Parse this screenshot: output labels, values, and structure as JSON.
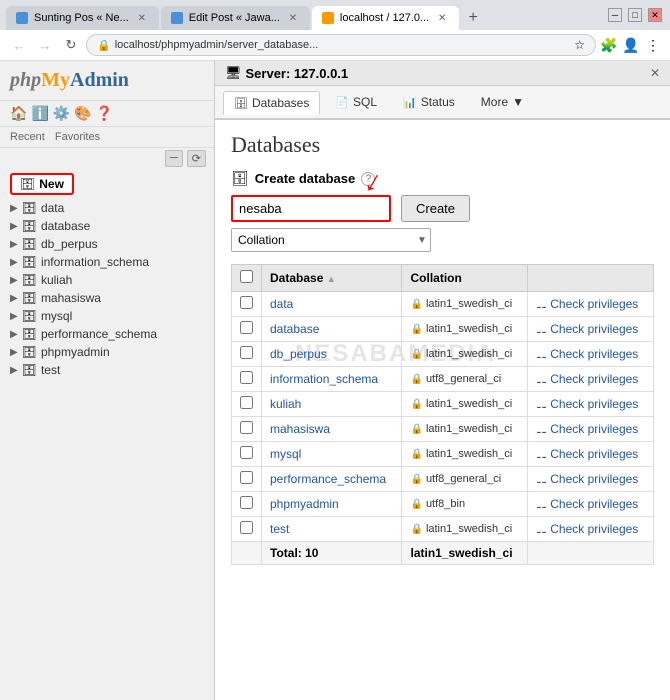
{
  "browser": {
    "tabs": [
      {
        "id": "tab1",
        "title": "Sunting Pos « Ne...",
        "favicon_color": "#4a90d9",
        "active": false
      },
      {
        "id": "tab2",
        "title": "Edit Post « Jawa...",
        "favicon_color": "#4a90d9",
        "active": false
      },
      {
        "id": "tab3",
        "title": "localhost / 127.0...",
        "favicon_color": "#f90",
        "active": true
      }
    ],
    "address": "localhost/phpmyadmin/server_database...",
    "new_tab_label": "+"
  },
  "sidebar": {
    "logo": "phpMyAdmin",
    "logo_php": "php",
    "logo_my": "My",
    "logo_admin": "Admin",
    "recent_label": "Recent",
    "favorites_label": "Favorites",
    "new_label": "New",
    "databases": [
      {
        "name": "data"
      },
      {
        "name": "database"
      },
      {
        "name": "db_perpus"
      },
      {
        "name": "information_schema"
      },
      {
        "name": "kuliah"
      },
      {
        "name": "mahasiswa"
      },
      {
        "name": "mysql"
      },
      {
        "name": "performance_schema"
      },
      {
        "name": "phpmyadmin"
      },
      {
        "name": "test"
      }
    ]
  },
  "server": {
    "title": "Server: 127.0.0.1"
  },
  "tabs": [
    {
      "id": "databases",
      "label": "Databases",
      "icon": "🗄"
    },
    {
      "id": "sql",
      "label": "SQL",
      "icon": "📄"
    },
    {
      "id": "status",
      "label": "Status",
      "icon": "📊"
    },
    {
      "id": "more",
      "label": "More",
      "icon": "▼"
    }
  ],
  "page": {
    "heading": "Databases",
    "create_label": "Create database",
    "db_name_value": "nesaba",
    "collation_placeholder": "Collation",
    "create_btn": "Create",
    "watermark": "NESABAMEDIA"
  },
  "table": {
    "headers": [
      "Database",
      "Collation",
      ""
    ],
    "rows": [
      {
        "name": "data",
        "collation": "latin1_swedish_ci",
        "action": "Check privileges"
      },
      {
        "name": "database",
        "collation": "latin1_swedish_ci",
        "action": "Check privileges"
      },
      {
        "name": "db_perpus",
        "collation": "latin1_swedish_ci",
        "action": "Check privileges"
      },
      {
        "name": "information_schema",
        "collation": "utf8_general_ci",
        "action": "Check privileges"
      },
      {
        "name": "kuliah",
        "collation": "latin1_swedish_ci",
        "action": "Check privileges"
      },
      {
        "name": "mahasiswa",
        "collation": "latin1_swedish_ci",
        "action": "Check privileges"
      },
      {
        "name": "mysql",
        "collation": "latin1_swedish_ci",
        "action": "Check privileges"
      },
      {
        "name": "performance_schema",
        "collation": "utf8_general_ci",
        "action": "Check privileges"
      },
      {
        "name": "phpmyadmin",
        "collation": "utf8_bin",
        "action": "Check privileges"
      },
      {
        "name": "test",
        "collation": "latin1_swedish_ci",
        "action": "Check privileges"
      }
    ],
    "total_label": "Total: 10",
    "total_collation": "latin1_swedish_ci"
  },
  "colors": {
    "accent": "#2255aa",
    "red": "#cc0000",
    "border_highlight": "#ff0000"
  }
}
